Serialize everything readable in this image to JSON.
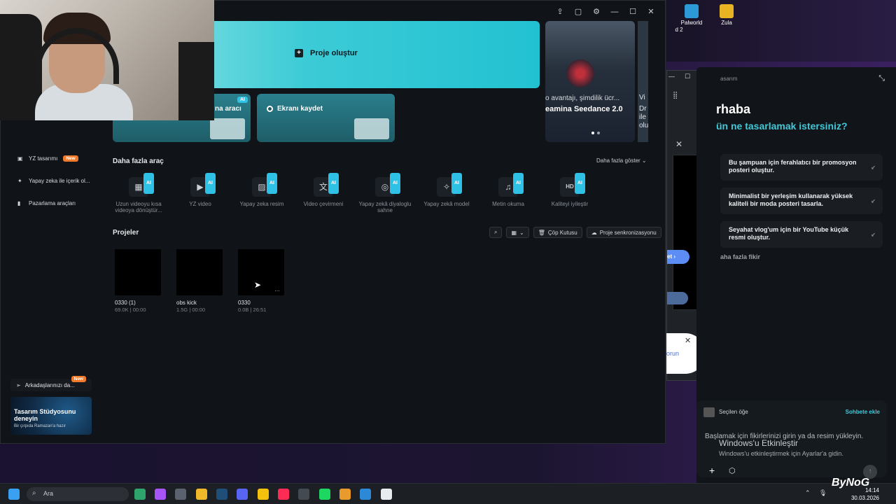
{
  "desktop": {
    "icons": [
      {
        "label": "Palworld",
        "color": "#2b9ad6"
      },
      {
        "label": "Zula",
        "color": "#e8b423"
      }
    ],
    "cut_label": "d 2"
  },
  "app": {
    "hero": {
      "create_label": "Proje oluştur"
    },
    "cards": [
      {
        "label": "na aracı"
      },
      {
        "label": "Ekranı kaydet"
      }
    ],
    "banner": {
      "line1": "o avantajı, şimdilik ücr...",
      "line2": "eamina Seedance 2.0"
    },
    "banner2": {
      "line1": "Vi",
      "line2": "Dr",
      "line3": "ile",
      "line4": "olu"
    },
    "more_tools_title": "Daha fazla araç",
    "show_more": "Daha fazla göster",
    "ai_tag": "AI",
    "tools": [
      {
        "label": "Uzun videoyu kısa videoya dönüştür...",
        "icon": "film-icon",
        "glyph": "▦"
      },
      {
        "label": "YZ video",
        "icon": "video-icon",
        "glyph": "▶"
      },
      {
        "label": "Yapay zeka resim",
        "icon": "image-icon",
        "glyph": "▨"
      },
      {
        "label": "Video çevirmeni",
        "icon": "translate-icon",
        "glyph": "文"
      },
      {
        "label": "Yapay zekâ diyaloglu sahne",
        "icon": "dialog-icon",
        "glyph": "◎"
      },
      {
        "label": "Yapay zekâ model",
        "icon": "model-icon",
        "glyph": "✧"
      },
      {
        "label": "Metin okuma",
        "icon": "tts-icon",
        "glyph": "♫"
      },
      {
        "label": "Kaliteyi iyileştir",
        "icon": "hd-icon",
        "glyph": "HD"
      }
    ],
    "projects_title": "Projeler",
    "project_buttons": {
      "trash": "Çöp Kutusu",
      "sync": "Proje senkronizasyonu"
    },
    "projects": [
      {
        "name": "0330 (1)",
        "meta": "69.0K | 00:00"
      },
      {
        "name": "obs kick",
        "meta": "1.5G | 00:00"
      },
      {
        "name": "0330",
        "meta": "0.0B | 26:51"
      }
    ],
    "sidebar": [
      {
        "label": "YZ tasarımı",
        "badge": "New"
      },
      {
        "label": "Yapay zeka ile içerik ol..."
      },
      {
        "label": "Pazarlama araçları"
      }
    ],
    "invite": {
      "label": "Arkadaşlarınızı da...",
      "badge": "New"
    },
    "promo": {
      "title": "Tasarım Stüdyosunu deneyin",
      "subtitle": "Bir çırpıda Ramazan'a hazır"
    }
  },
  "design_panel": {
    "header": "asarım",
    "greeting": "rhaba",
    "question": "ün ne tasarlamak istersiniz?",
    "suggestions": [
      "Bu şampuan için ferahlatıcı bir promosyon posteri oluştur.",
      "Minimalist bir yerleşim kullanarak yüksek kaliteli bir moda posteri tasarla.",
      "Seyahat vlog'um için bir YouTube küçük resmi oluştur."
    ],
    "more_ideas": "aha fazla fikir",
    "selected": "Seçilen öğe",
    "add_chat": "Sohbete ekle",
    "hint": "Başlamak için fikirlerinizi girin ya da resim yükleyin.",
    "activate_title": "Windows'u Etkinleştir",
    "activate_sub": "Windows'u etkinleştirmek için Ayarlar'a gidin."
  },
  "browser": {
    "pill": "et ›",
    "bubble": "orun"
  },
  "taskbar": {
    "search_placeholder": "Ara",
    "time": "14:14",
    "date": "30.03.2026",
    "watermark": "ByNoG"
  },
  "colors": {
    "accent": "#2fc0e6",
    "new_badge": "#f07a2c",
    "hero_start": "#8fe3e4",
    "hero_end": "#22c1d2"
  }
}
